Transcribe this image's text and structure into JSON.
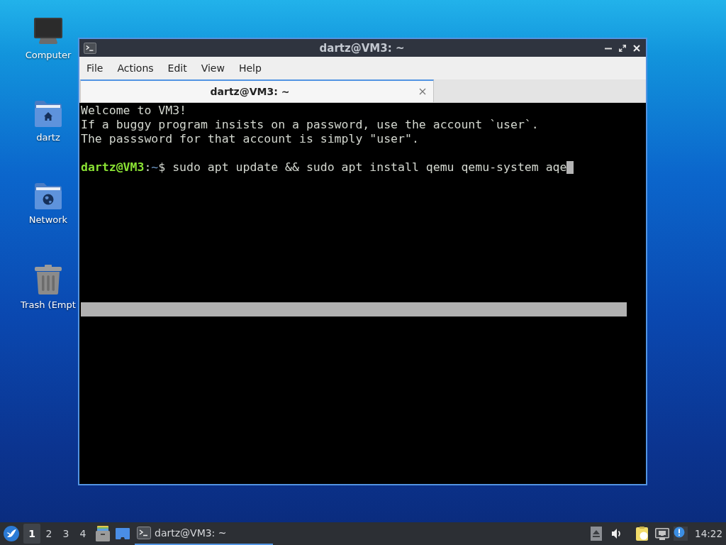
{
  "desktop_icons": [
    {
      "kind": "computer",
      "label": "Computer"
    },
    {
      "kind": "home_folder",
      "label": "dartz"
    },
    {
      "kind": "network",
      "label": "Network"
    },
    {
      "kind": "trash",
      "label": "Trash (Empt"
    }
  ],
  "window": {
    "title": "dartz@VM3: ~",
    "menu": [
      "File",
      "Actions",
      "Edit",
      "View",
      "Help"
    ],
    "tabs": [
      {
        "label": "dartz@VM3: ~",
        "selected": true
      }
    ],
    "terminal": {
      "lines": [
        {
          "kind": "output",
          "text": "Welcome to VM3!"
        },
        {
          "kind": "output",
          "text": "If a buggy program insists on a password, use the account `user`."
        },
        {
          "kind": "output",
          "text": "The passsword for that account is simply \"user\"."
        },
        {
          "kind": "blank"
        },
        {
          "kind": "prompt",
          "user_host": "dartz@VM3",
          "separator": ":",
          "path": "~",
          "symbol": "$",
          "command": "sudo apt update && sudo apt install qemu qemu-system aqe"
        }
      ]
    }
  },
  "taskbar": {
    "workspaces": [
      {
        "label": "1",
        "selected": true
      },
      {
        "label": "2",
        "selected": false
      },
      {
        "label": "3",
        "selected": false
      },
      {
        "label": "4",
        "selected": false
      }
    ],
    "tasks": [
      {
        "title": "dartz@VM3: ~",
        "active": true
      }
    ],
    "clock": "14:22"
  }
}
